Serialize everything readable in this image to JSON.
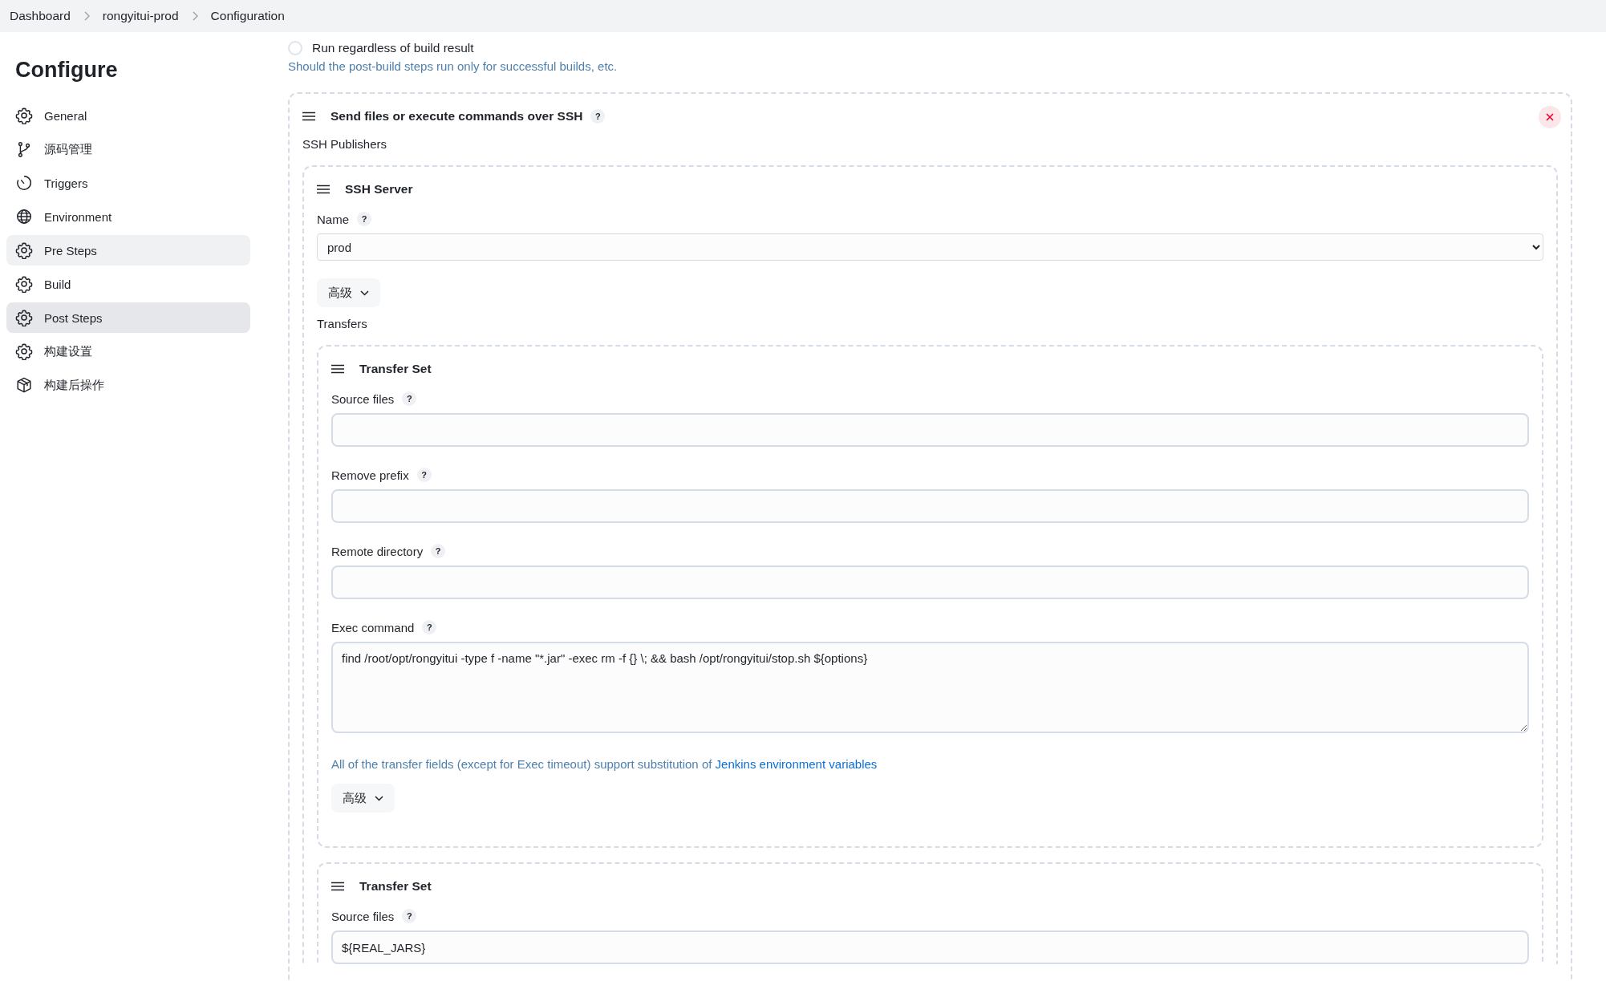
{
  "breadcrumbs": [
    {
      "label": "Dashboard"
    },
    {
      "label": "rongyitui-prod"
    },
    {
      "label": "Configuration"
    }
  ],
  "sidebar": {
    "title": "Configure",
    "items": [
      {
        "label": "General",
        "kind": "gear",
        "selected": false,
        "hovered": false
      },
      {
        "label": "源码管理",
        "kind": "branch",
        "selected": false,
        "hovered": false
      },
      {
        "label": "Triggers",
        "kind": "clock",
        "selected": false,
        "hovered": false
      },
      {
        "label": "Environment",
        "kind": "globe",
        "selected": false,
        "hovered": false
      },
      {
        "label": "Pre Steps",
        "kind": "gear",
        "selected": false,
        "hovered": true
      },
      {
        "label": "Build",
        "kind": "gear",
        "selected": false,
        "hovered": false
      },
      {
        "label": "Post Steps",
        "kind": "gear",
        "selected": true,
        "hovered": false
      },
      {
        "label": "构建设置",
        "kind": "gear",
        "selected": false,
        "hovered": false
      },
      {
        "label": "构建后操作",
        "kind": "package",
        "selected": false,
        "hovered": false
      }
    ]
  },
  "run_regardless": {
    "label": "Run regardless of build result",
    "checked": false,
    "hint": "Should the post-build steps run only for successful builds, etc."
  },
  "publisher": {
    "title": "Send files or execute commands over SSH",
    "help": "?",
    "section_label": "SSH Publishers",
    "server": {
      "title": "SSH Server",
      "name_label": "Name",
      "name_help": "?",
      "name_value": "prod",
      "advanced_button": "高级",
      "transfers_label": "Transfers",
      "transfer_sets": [
        {
          "title": "Transfer Set",
          "fields": [
            {
              "kind": "input",
              "label": "Source files",
              "help": "?"
            },
            {
              "kind": "input",
              "label": "Remove prefix",
              "help": "?"
            },
            {
              "kind": "input",
              "label": "Remote directory",
              "help": "?"
            },
            {
              "kind": "textarea",
              "label": "Exec command",
              "help": "?",
              "value": "find /root/opt/rongyitui -type f -name \"*.jar\" -exec rm -f {} \\; && bash /opt/rongyitui/stop.sh ${options}"
            }
          ],
          "footnote": {
            "text": "All of the transfer fields (except for Exec timeout) support substitution of ",
            "link": "Jenkins environment variables"
          },
          "advanced_button": "高级"
        },
        {
          "title": "Transfer Set",
          "fields": [
            {
              "kind": "input",
              "label": "Source files",
              "help": "?",
              "value": "${REAL_JARS}"
            }
          ]
        }
      ]
    }
  }
}
